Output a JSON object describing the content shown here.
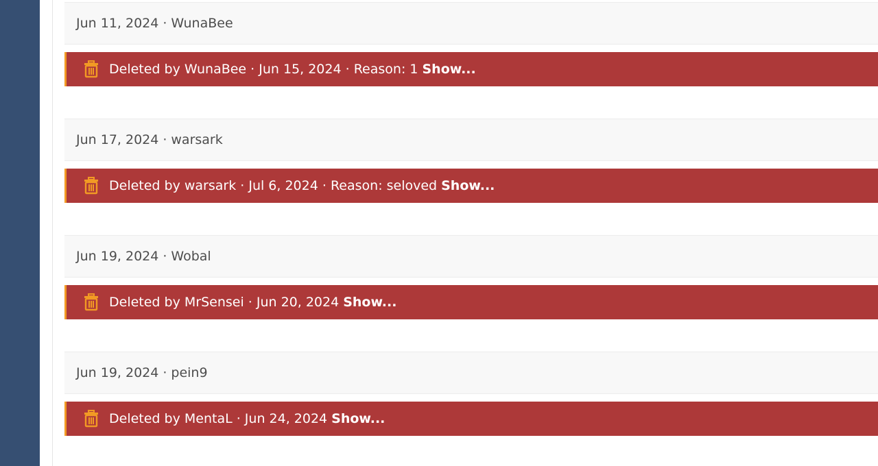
{
  "colors": {
    "sidebar": "#364f72",
    "deleted_bar": "#ad3939",
    "accent": "#f29a24"
  },
  "separator": "·",
  "posts": [
    {
      "date": "Jun 11, 2024",
      "author": "WunaBee",
      "deleted_text": "Deleted by WunaBee · Jun 15, 2024 · Reason: 1",
      "show_label": "Show..."
    },
    {
      "date": "Jun 17, 2024",
      "author": "warsark",
      "deleted_text": "Deleted by warsark · Jul 6, 2024 · Reason: seloved",
      "show_label": "Show..."
    },
    {
      "date": "Jun 19, 2024",
      "author": "Wobal",
      "deleted_text": "Deleted by MrSensei · Jun 20, 2024",
      "show_label": "Show..."
    },
    {
      "date": "Jun 19, 2024",
      "author": "pein9",
      "deleted_text": "Deleted by MentaL · Jun 24, 2024",
      "show_label": "Show..."
    }
  ]
}
